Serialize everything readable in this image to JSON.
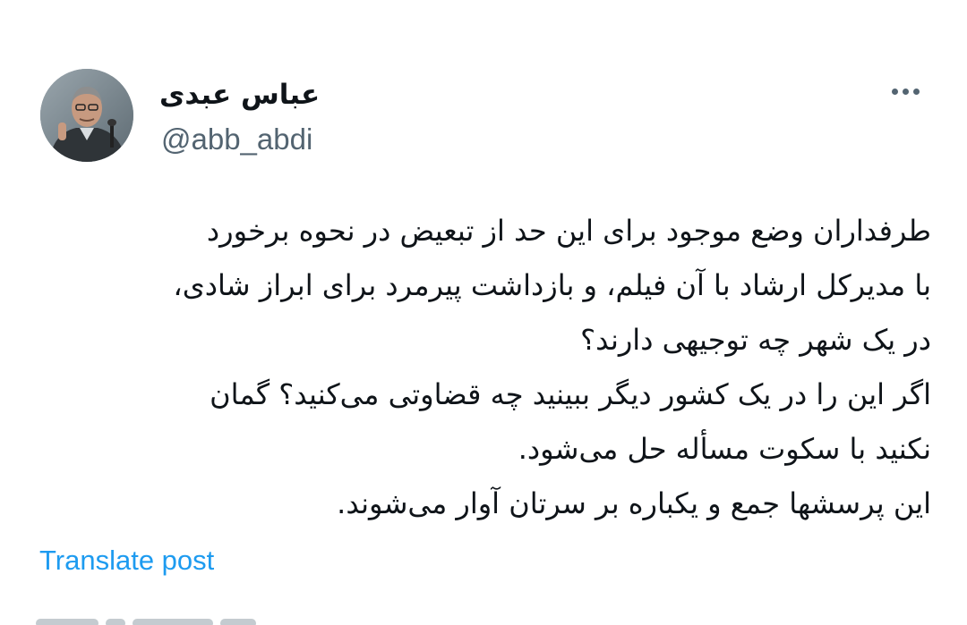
{
  "author": {
    "display_name": "عباس عبدی",
    "handle": "@abb_abdi",
    "avatar_icon": "profile-photo"
  },
  "menu": {
    "icon": "more-horizontal-icon"
  },
  "tweet": {
    "lines": [
      "طرفداران وضع موجود برای این حد از تبعیض در نحوه برخورد",
      "با مدیرکل ارشاد با آن فیلم، و بازداشت پیرمرد برای ابراز شادی،",
      "در یک شهر چه توجیهی دارند؟",
      "اگر این را در یک کشور دیگر ببینید چه قضاوتی می‌کنید؟ گمان",
      "نکنید با سکوت مسأله حل می‌شود.",
      "این پرسشها جمع و یکباره بر سرتان آوار می‌شوند."
    ]
  },
  "actions": {
    "translate_label": "Translate post"
  },
  "colors": {
    "text": "#0f1419",
    "secondary": "#536471",
    "link": "#1d9bf0",
    "background": "#ffffff"
  }
}
